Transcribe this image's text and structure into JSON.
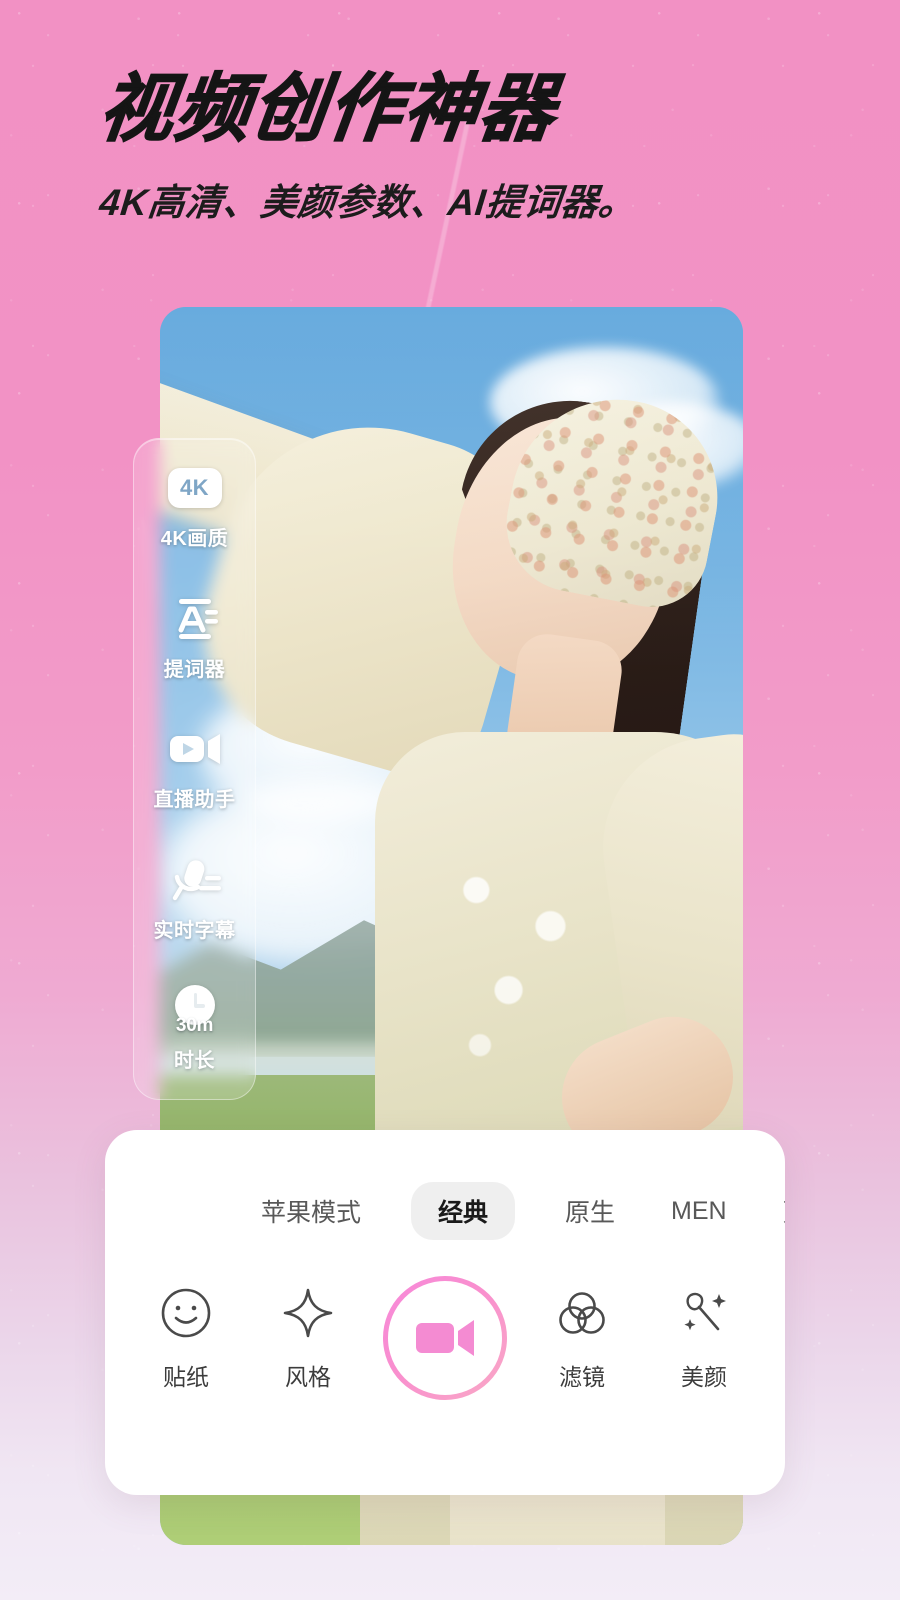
{
  "promo": {
    "headline": "视频创作神器",
    "subheadline": "4K高清、美颜参数、AI提词器。"
  },
  "colors": {
    "background_pink": "#F291C4",
    "background_bottom": "#F3EDF7",
    "record_ring_start": "#F789DA",
    "record_ring_end": "#F9A9C6",
    "record_icon": "#F48BD2",
    "tab_active_bg": "#EFEFEF",
    "badge_4k_text": "#7FA6C6"
  },
  "sidebar": {
    "items": [
      {
        "icon": "4k-badge-icon",
        "label": "4K画质",
        "badge_text": "4K"
      },
      {
        "icon": "teleprompter-icon",
        "label": "提词器"
      },
      {
        "icon": "video-camera-icon",
        "label": "直播助手"
      },
      {
        "icon": "microphone-subtitle-icon",
        "label": "实时字幕"
      },
      {
        "icon": "clock-duration-icon",
        "label": "时长",
        "badge_text": "30m"
      }
    ]
  },
  "control_card": {
    "tabs": [
      {
        "label": "苹果模式",
        "active": false
      },
      {
        "label": "经典",
        "active": true
      },
      {
        "label": "原生",
        "active": false
      },
      {
        "label": "MEN",
        "active": false
      },
      {
        "label": "更多",
        "active": false
      }
    ],
    "actions": [
      {
        "icon": "sticker-smiley-icon",
        "label": "贴纸"
      },
      {
        "icon": "style-sparkle-icon",
        "label": "风格"
      },
      {
        "icon": "filter-circles-icon",
        "label": "滤镜"
      },
      {
        "icon": "beauty-wand-icon",
        "label": "美颜"
      }
    ],
    "record_button": {
      "icon": "record-video-icon",
      "label": ""
    }
  }
}
